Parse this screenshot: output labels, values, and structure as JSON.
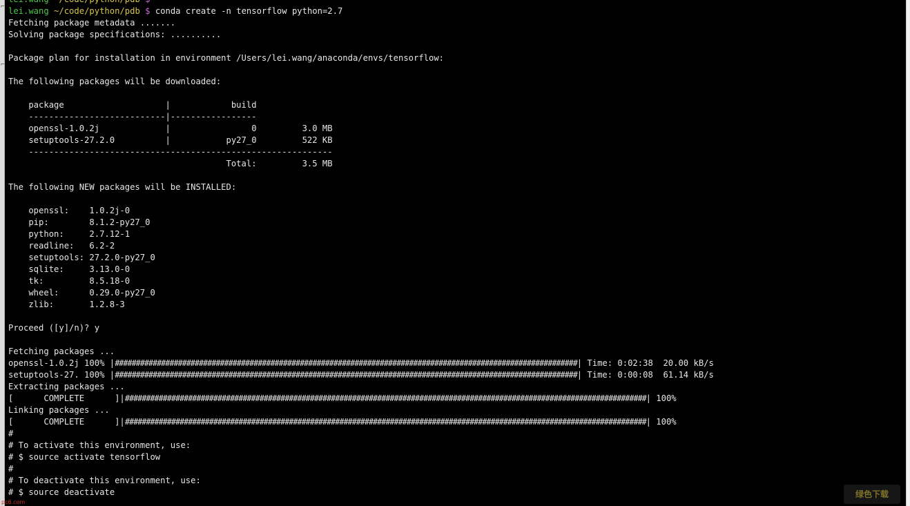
{
  "prompt": {
    "user": "lei.wang",
    "path": "~/code/python/pdb",
    "sign": "$"
  },
  "lines": {
    "cmd": "conda create -n tensorflow python=2.7",
    "fetch_meta": "Fetching package metadata .......",
    "solve": "Solving package specifications: ..........",
    "plan": "Package plan for installation in environment /Users/lei.wang/anaconda/envs/tensorflow:",
    "dl_heading": "The following packages will be downloaded:",
    "table_head": "    package                    |            build",
    "table_sep1": "    ---------------------------|-----------------",
    "row_openssl": "    openssl-1.0.2j             |                0         3.0 MB",
    "row_setuptools": "    setuptools-27.2.0          |           py27_0         522 KB",
    "table_sep2": "    ------------------------------------------------------------",
    "table_total": "                                           Total:         3.5 MB",
    "new_heading": "The following NEW packages will be INSTALLED:",
    "new_openssl": "    openssl:    1.0.2j-0",
    "new_pip": "    pip:        8.1.2-py27_0",
    "new_python": "    python:     2.7.12-1",
    "new_readline": "    readline:   6.2-2",
    "new_setuptools": "    setuptools: 27.2.0-py27_0",
    "new_sqlite": "    sqlite:     3.13.0-0",
    "new_tk": "    tk:         8.5.18-0",
    "new_wheel": "    wheel:      0.29.0-py27_0",
    "new_zlib": "    zlib:       1.2.8-3",
    "proceed": "Proceed ([y]/n)? y",
    "fetch_pkgs": "Fetching packages ...",
    "dl1_prefix": "openssl-1.0.2j 100% |",
    "dl1_suffix": "| Time: 0:02:38  20.00 kB/s",
    "dl2_prefix": "setuptools-27. 100% |",
    "dl2_suffix": "| Time: 0:00:08  61.14 kB/s",
    "extract": "Extracting packages ...",
    "ext_prefix": "[      COMPLETE      ]|",
    "ext_suffix": "| 100%",
    "link": "Linking packages ...",
    "lnk_prefix": "[      COMPLETE      ]|",
    "lnk_suffix": "| 100%",
    "hash1": "#",
    "activate_note": "# To activate this environment, use:",
    "activate_cmd": "# $ source activate tensorflow",
    "hash2": "#",
    "deactivate_note": "# To deactivate this environment, use:",
    "deactivate_cmd": "# $ source deactivate"
  },
  "progress": {
    "download_openssl": 1.0,
    "download_setuptools": 1.0,
    "extracting": 1.0,
    "linking": 1.0
  },
  "watermark": {
    "left": "pc6.com",
    "right": "绿色下载"
  },
  "colors": {
    "background": "#000000",
    "foreground": "#e6e6e6",
    "prompt_user": "#4fc34a",
    "prompt_path": "#d8c64a",
    "prompt_sign": "#c76ad8"
  }
}
